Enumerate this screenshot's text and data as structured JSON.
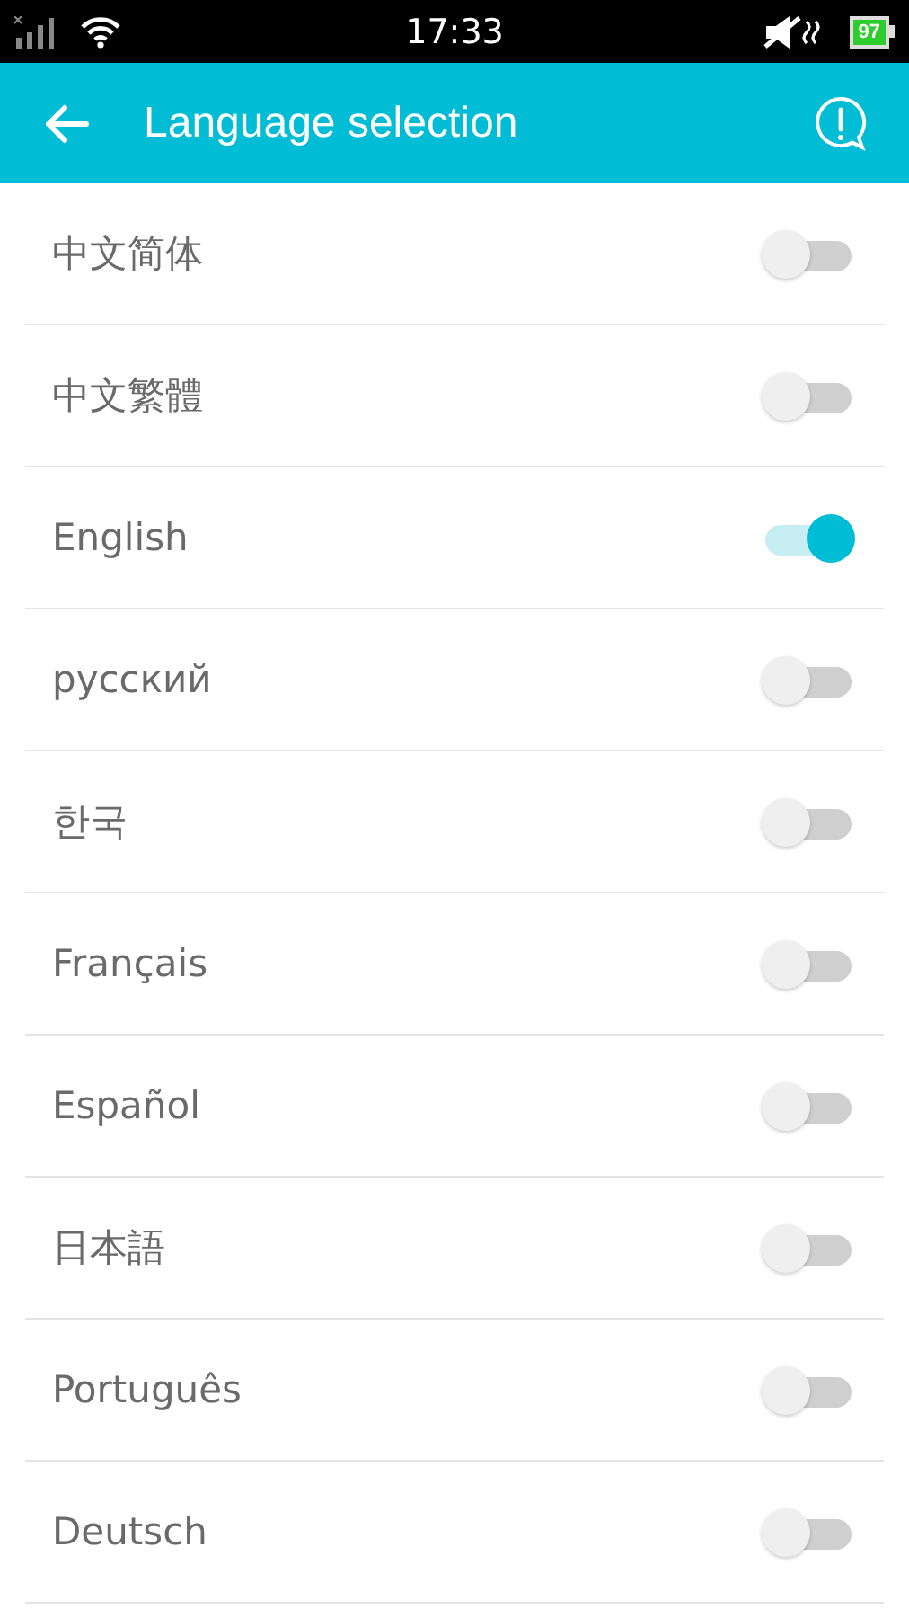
{
  "status_bar": {
    "time": "17:33",
    "battery": "97"
  },
  "app_bar": {
    "title": "Language selection"
  },
  "languages": [
    {
      "label": "中文简体",
      "on": false
    },
    {
      "label": "中文繁體",
      "on": false
    },
    {
      "label": "English",
      "on": true
    },
    {
      "label": "русский",
      "on": false
    },
    {
      "label": "한국",
      "on": false
    },
    {
      "label": "Français",
      "on": false
    },
    {
      "label": "Español",
      "on": false
    },
    {
      "label": "日本語",
      "on": false
    },
    {
      "label": "Português",
      "on": false
    },
    {
      "label": "Deutsch",
      "on": false
    }
  ]
}
